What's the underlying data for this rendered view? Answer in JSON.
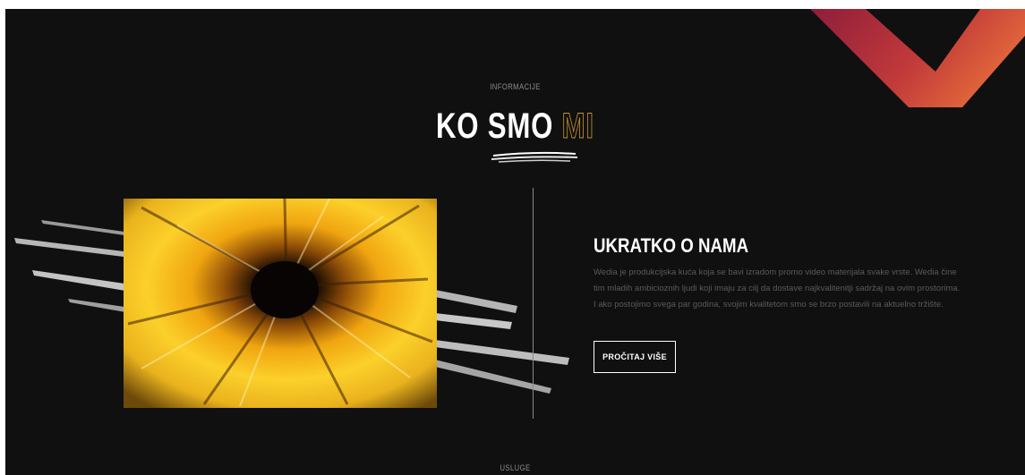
{
  "about": {
    "eyebrow": "INFORMACIJE",
    "title_main": "KO SMO",
    "title_accent": "MI",
    "heading": "UKRATKO O NAMA",
    "body": "Wedia je produkcijska kuća koja se bavi izradom promo video materijala svake vrste. Wedia čine tim mladih ambicioznih ljudi koji imaju za cilj da dostave najkvalitenitji sadržaj na ovim prostorima. I ako postojimo svega par godina, svojim kvalitetom smo se brzo postavili na aktuelno tržište.",
    "button_label": "PROČITAJ VIŠE",
    "image": "abstract-yellow-fluid-art"
  },
  "next_section": {
    "eyebrow": "USLUGE"
  },
  "colors": {
    "background": "#101010",
    "accent_gold": "#c9952f",
    "brand_red": "#b8323a",
    "brand_orange": "#e0603a",
    "text_muted": "#5a5a5a"
  }
}
